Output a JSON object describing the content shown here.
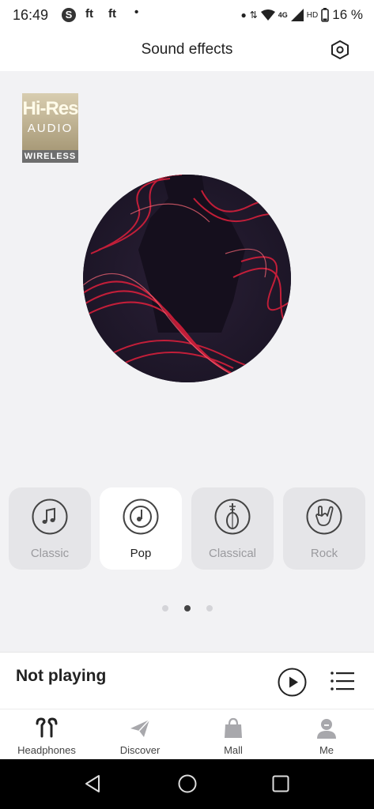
{
  "status_bar": {
    "time": "16:49",
    "notif_icons": [
      "S",
      "ft",
      "ft"
    ],
    "network": "4G",
    "hd": "HD",
    "battery": "16 %"
  },
  "header": {
    "title": "Sound effects"
  },
  "badge": {
    "line1": "Hi-Res",
    "line2": "AUDIO",
    "line3": "WIRELESS"
  },
  "presets": [
    {
      "label": "Classic",
      "icon": "music-note-icon",
      "active": false
    },
    {
      "label": "Pop",
      "icon": "disc-icon",
      "active": true
    },
    {
      "label": "Classical",
      "icon": "pipa-icon",
      "active": false
    },
    {
      "label": "Rock",
      "icon": "rock-hand-icon",
      "active": false
    }
  ],
  "pager": {
    "count": 3,
    "active_index": 1
  },
  "player": {
    "status": "Not playing"
  },
  "tabs": [
    {
      "label": "Headphones",
      "icon": "earbuds-icon"
    },
    {
      "label": "Discover",
      "icon": "paper-plane-icon"
    },
    {
      "label": "Mall",
      "icon": "shopping-bag-icon"
    },
    {
      "label": "Me",
      "icon": "person-icon"
    }
  ],
  "colors": {
    "accent": "#222222",
    "inactive": "#9a9a9e",
    "art_red": "#e0203c"
  }
}
